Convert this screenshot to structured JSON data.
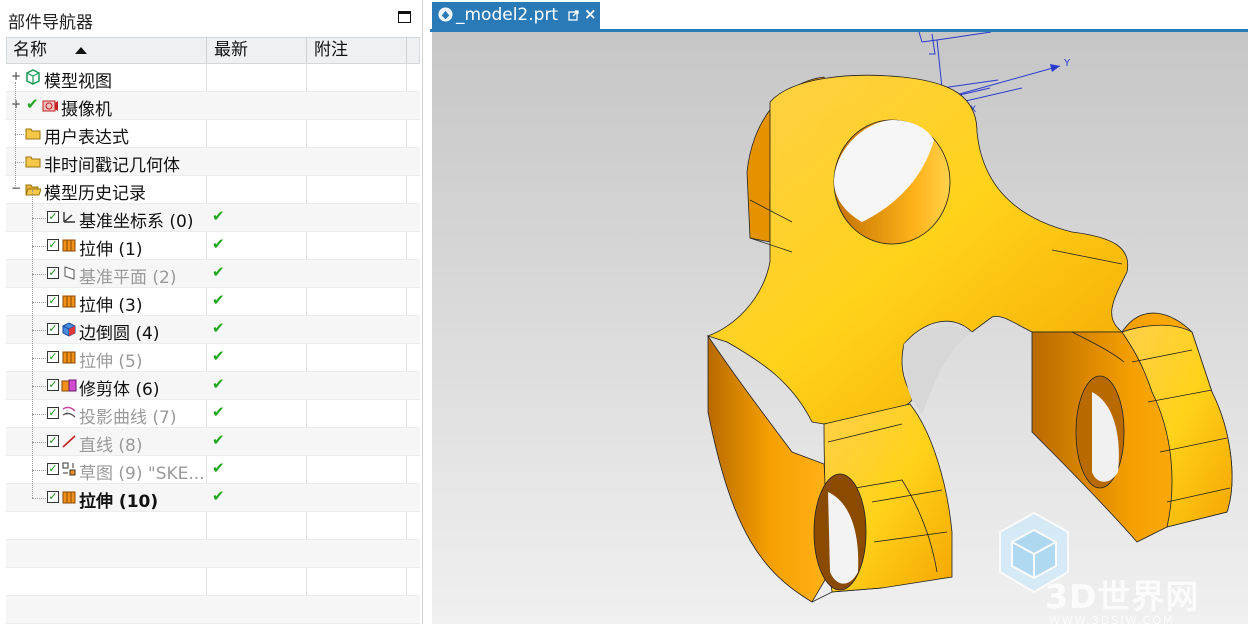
{
  "navigator": {
    "title": "部件导航器",
    "columns": {
      "name": "名称",
      "latest": "最新",
      "note": "附注"
    },
    "rows": [
      {
        "label": "模型视图",
        "latest": "",
        "style": "normal"
      },
      {
        "label": "摄像机",
        "latest": "",
        "style": "normal"
      },
      {
        "label": "用户表达式",
        "latest": "",
        "style": "normal"
      },
      {
        "label": "非时间戳记几何体",
        "latest": "",
        "style": "normal"
      },
      {
        "label": "模型历史记录",
        "latest": "",
        "style": "normal"
      },
      {
        "label": "基准坐标系 (0)",
        "latest": "✔",
        "style": "normal"
      },
      {
        "label": "拉伸 (1)",
        "latest": "✔",
        "style": "normal"
      },
      {
        "label": "基准平面 (2)",
        "latest": "✔",
        "style": "dim"
      },
      {
        "label": "拉伸 (3)",
        "latest": "✔",
        "style": "normal"
      },
      {
        "label": "边倒圆 (4)",
        "latest": "✔",
        "style": "normal"
      },
      {
        "label": "拉伸 (5)",
        "latest": "✔",
        "style": "dim"
      },
      {
        "label": "修剪体 (6)",
        "latest": "✔",
        "style": "normal"
      },
      {
        "label": "投影曲线 (7)",
        "latest": "✔",
        "style": "dim"
      },
      {
        "label": "直线 (8)",
        "latest": "✔",
        "style": "dim"
      },
      {
        "label": "草图 (9) \"SKE...",
        "latest": "✔",
        "style": "dim"
      },
      {
        "label": "拉伸 (10)",
        "latest": "✔",
        "style": "bold"
      }
    ]
  },
  "graphics": {
    "tab_title": "_model2.prt",
    "axis_labels": {
      "y": "Y",
      "x": "X"
    },
    "watermark": {
      "text": "3D世界网",
      "url": "WWW.3DSJW.COM"
    },
    "part_color": "#f5a300"
  }
}
